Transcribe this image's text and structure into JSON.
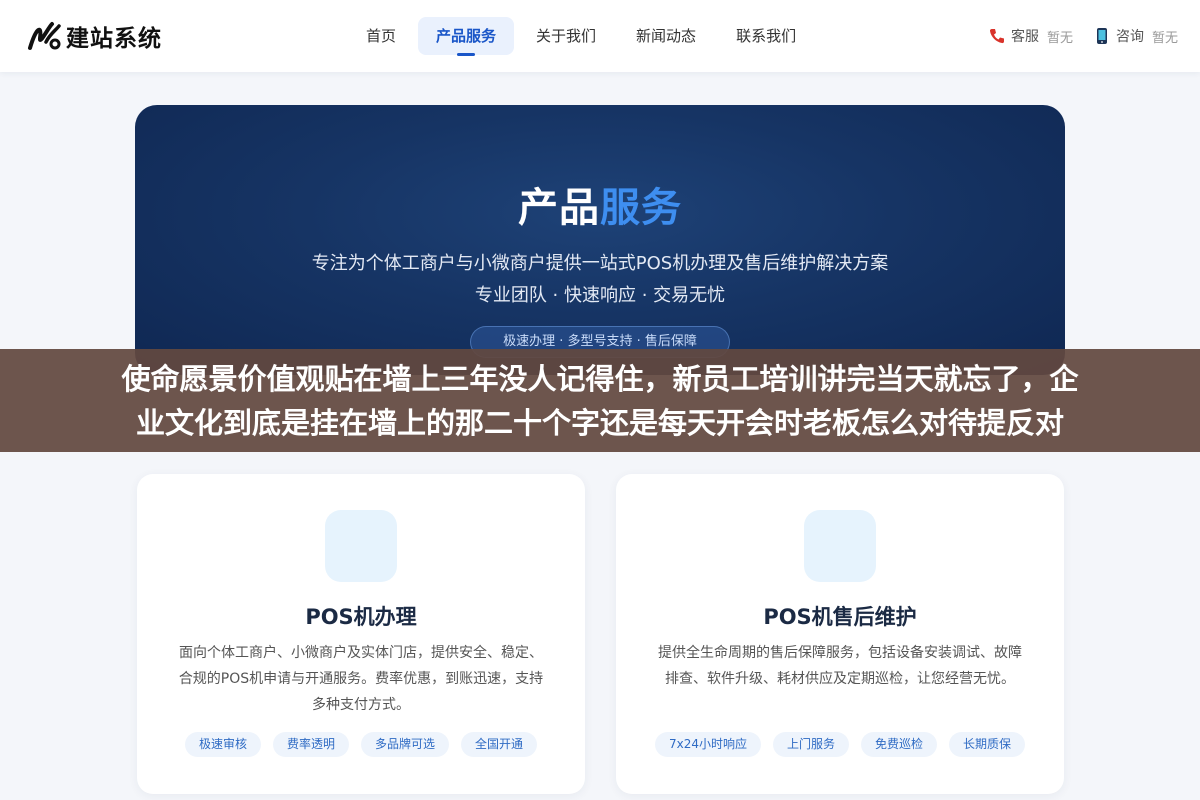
{
  "header": {
    "logo_text": "建站系统",
    "nav": [
      {
        "label": "首页",
        "active": false
      },
      {
        "label": "产品服务",
        "active": true
      },
      {
        "label": "关于我们",
        "active": false
      },
      {
        "label": "新闻动态",
        "active": false
      },
      {
        "label": "联系我们",
        "active": false
      }
    ],
    "contacts": [
      {
        "icon": "phone-icon",
        "label": "客服",
        "value": "暂无"
      },
      {
        "icon": "mobile-icon",
        "label": "咨询",
        "value": "暂无"
      }
    ]
  },
  "hero": {
    "title_main": "产品",
    "title_highlight": "服务",
    "subtitle_line1": "专注为个体工商户与小微商户提供一站式POS机办理及售后维护解决方案",
    "subtitle_line2": "专业团队 · 快速响应 · 交易无忧",
    "badge": "极速办理 · 多型号支持 · 售后保障"
  },
  "overlay": {
    "line1": "使命愿景价值观贴在墙上三年没人记得住，新员工培训讲完当天就忘了，企",
    "line2": "业文化到底是挂在墙上的那二十个字还是每天开会时老板怎么对待提反对"
  },
  "cards": [
    {
      "title": "POS机办理",
      "description": "面向个体工商户、小微商户及实体门店，提供安全、稳定、合规的POS机申请与开通服务。费率优惠，到账迅速，支持多种支付方式。",
      "tags": [
        "极速审核",
        "费率透明",
        "多品牌可选",
        "全国开通"
      ]
    },
    {
      "title": "POS机售后维护",
      "description": "提供全生命周期的售后保障服务，包括设备安装调试、故障排查、软件升级、耗材供应及定期巡检，让您经营无忧。",
      "tags": [
        "7x24小时响应",
        "上门服务",
        "免费巡检",
        "长期质保"
      ]
    }
  ],
  "colors": {
    "accent": "#1a56c8",
    "hero_bg": "#163464",
    "hero_highlight": "#3e8ef0",
    "overlay_bg": "#624840"
  }
}
